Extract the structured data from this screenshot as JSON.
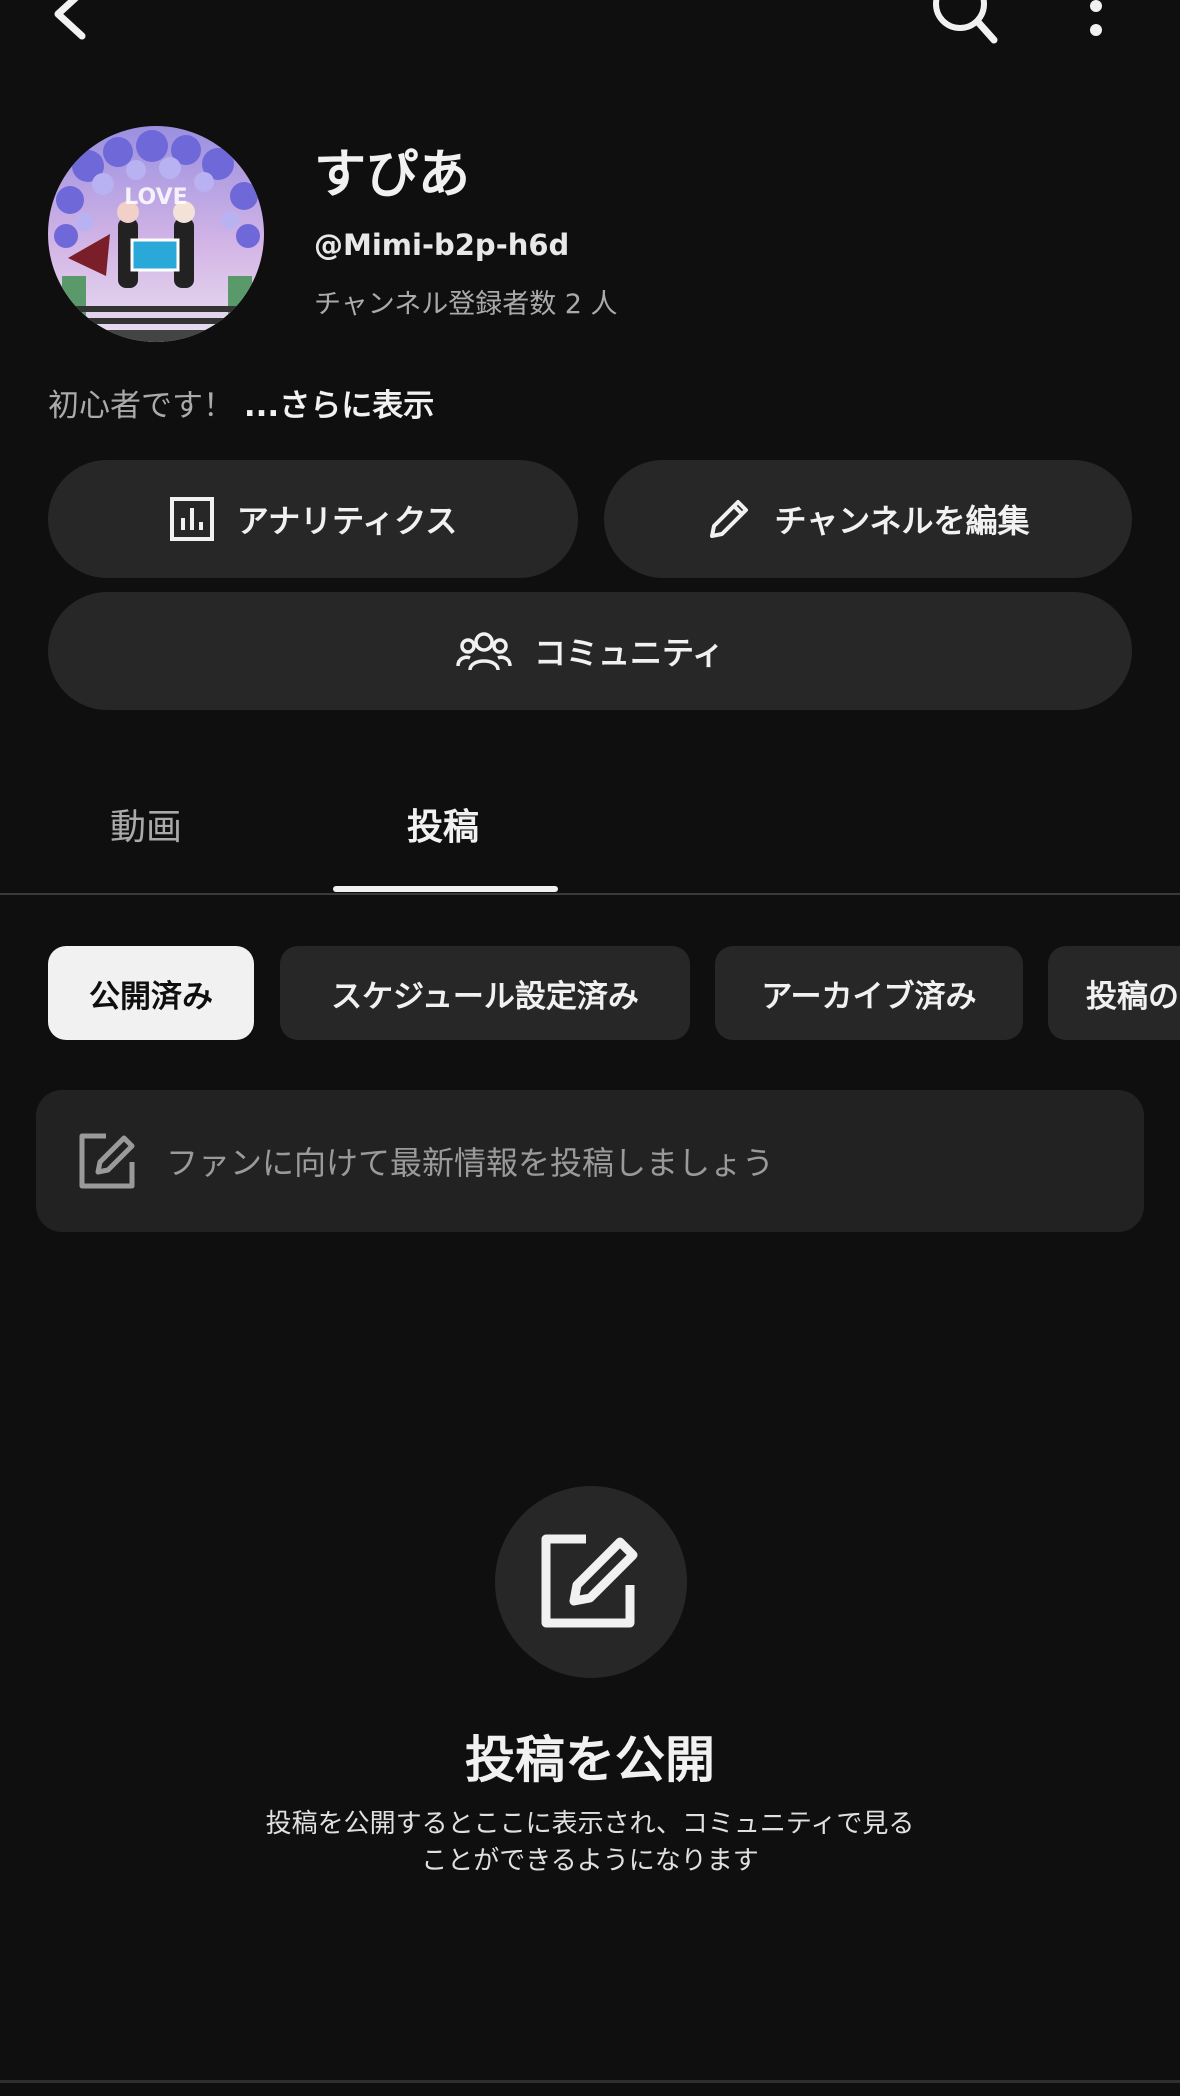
{
  "profile": {
    "name": "すぴあ",
    "handle": "@Mimi-b2p-h6d",
    "subscribers": "チャンネル登録者数 2 人",
    "avatar_sign": "LOVE",
    "description": "初心者です！",
    "more_label": "...さらに表示"
  },
  "actions": {
    "analytics_label": "アナリティクス",
    "edit_channel_label": "チャンネルを編集",
    "community_label": "コミュニティ"
  },
  "tabs": [
    {
      "label": "動画",
      "active": false
    },
    {
      "label": "投稿",
      "active": true
    }
  ],
  "chips": [
    {
      "label": "公開済み",
      "active": true
    },
    {
      "label": "スケジュール設定済み",
      "active": false
    },
    {
      "label": "アーカイブ済み",
      "active": false
    },
    {
      "label": "投稿の",
      "active": false
    }
  ],
  "composer": {
    "placeholder": "ファンに向けて最新情報を投稿しましょう"
  },
  "empty_state": {
    "title": "投稿を公開",
    "line1": "投稿を公開するとここに表示され、コミュニティで見る",
    "line2": "ことができるようになります"
  },
  "icons": {
    "back": "back-arrow-icon",
    "search": "search-icon",
    "more": "more-vertical-icon",
    "analytics": "bar-chart-icon",
    "edit": "pencil-icon",
    "community": "people-icon",
    "compose": "edit-square-icon"
  },
  "colors": {
    "background": "#0f0f0f",
    "surface": "#272727",
    "text_primary": "#f1f1f1",
    "text_secondary": "#aaaaaa"
  }
}
